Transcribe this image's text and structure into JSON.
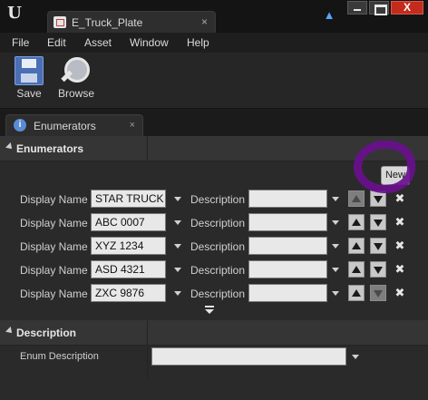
{
  "titlebar": {
    "logo": "U",
    "tab_title": "E_Truck_Plate",
    "tab_close": "×",
    "help_icon": "help-icon",
    "close_glyph": "X"
  },
  "menu": {
    "items": [
      "File",
      "Edit",
      "Asset",
      "Window",
      "Help"
    ]
  },
  "toolbar": {
    "save_label": "Save",
    "browse_label": "Browse"
  },
  "panel": {
    "tab_label": "Enumerators",
    "tab_icon_glyph": "i",
    "tab_close": "×"
  },
  "sections": {
    "enumerators_label": "Enumerators",
    "description_label": "Description"
  },
  "new_button_label": "New",
  "rows": [
    {
      "display_name_label": "Display Name",
      "display_name": "STAR TRUCK",
      "description_label": "Description",
      "description": ""
    },
    {
      "display_name_label": "Display Name",
      "display_name": "ABC 0007",
      "description_label": "Description",
      "description": ""
    },
    {
      "display_name_label": "Display Name",
      "display_name": "XYZ 1234",
      "description_label": "Description",
      "description": ""
    },
    {
      "display_name_label": "Display Name",
      "display_name": "ASD 4321",
      "description_label": "Description",
      "description": ""
    },
    {
      "display_name_label": "Display Name",
      "display_name": "ZXC 9876",
      "description_label": "Description",
      "description": ""
    }
  ],
  "enum_description": {
    "label": "Enum Description",
    "value": ""
  },
  "colors": {
    "annotation": "#6a0f8e",
    "close_button": "#c42b1c",
    "background": "#2a2a2a"
  }
}
